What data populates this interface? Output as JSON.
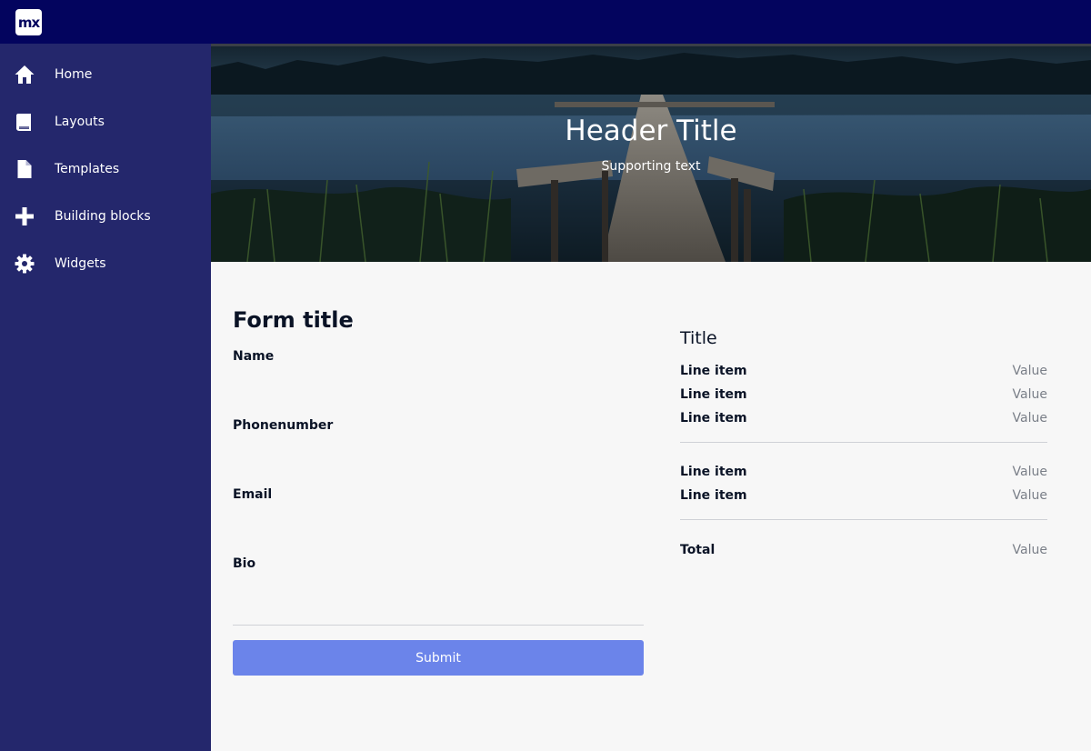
{
  "app": {
    "logo_text": "mx"
  },
  "sidebar": {
    "items": [
      {
        "label": "Home",
        "icon": "home-icon"
      },
      {
        "label": "Layouts",
        "icon": "book-icon"
      },
      {
        "label": "Templates",
        "icon": "file-icon"
      },
      {
        "label": "Building blocks",
        "icon": "plus-icon"
      },
      {
        "label": "Widgets",
        "icon": "gear-icon"
      }
    ]
  },
  "header": {
    "title": "Header Title",
    "subtitle": "Supporting text"
  },
  "form": {
    "title": "Form title",
    "fields": [
      {
        "label": "Name",
        "value": ""
      },
      {
        "label": "Phonenumber",
        "value": ""
      },
      {
        "label": "Email",
        "value": ""
      },
      {
        "label": "Bio",
        "value": ""
      }
    ],
    "submit_label": "Submit"
  },
  "summary": {
    "title": "Title",
    "group1": [
      {
        "label": "Line item",
        "value": "Value"
      },
      {
        "label": "Line item",
        "value": "Value"
      },
      {
        "label": "Line item",
        "value": "Value"
      }
    ],
    "group2": [
      {
        "label": "Line item",
        "value": "Value"
      },
      {
        "label": "Line item",
        "value": "Value"
      }
    ],
    "total": {
      "label": "Total",
      "value": "Value"
    }
  },
  "colors": {
    "topbar": "#03045e",
    "sidebar": "#24276c",
    "primary_button": "#6b84ea",
    "background": "#f7f7f7"
  }
}
